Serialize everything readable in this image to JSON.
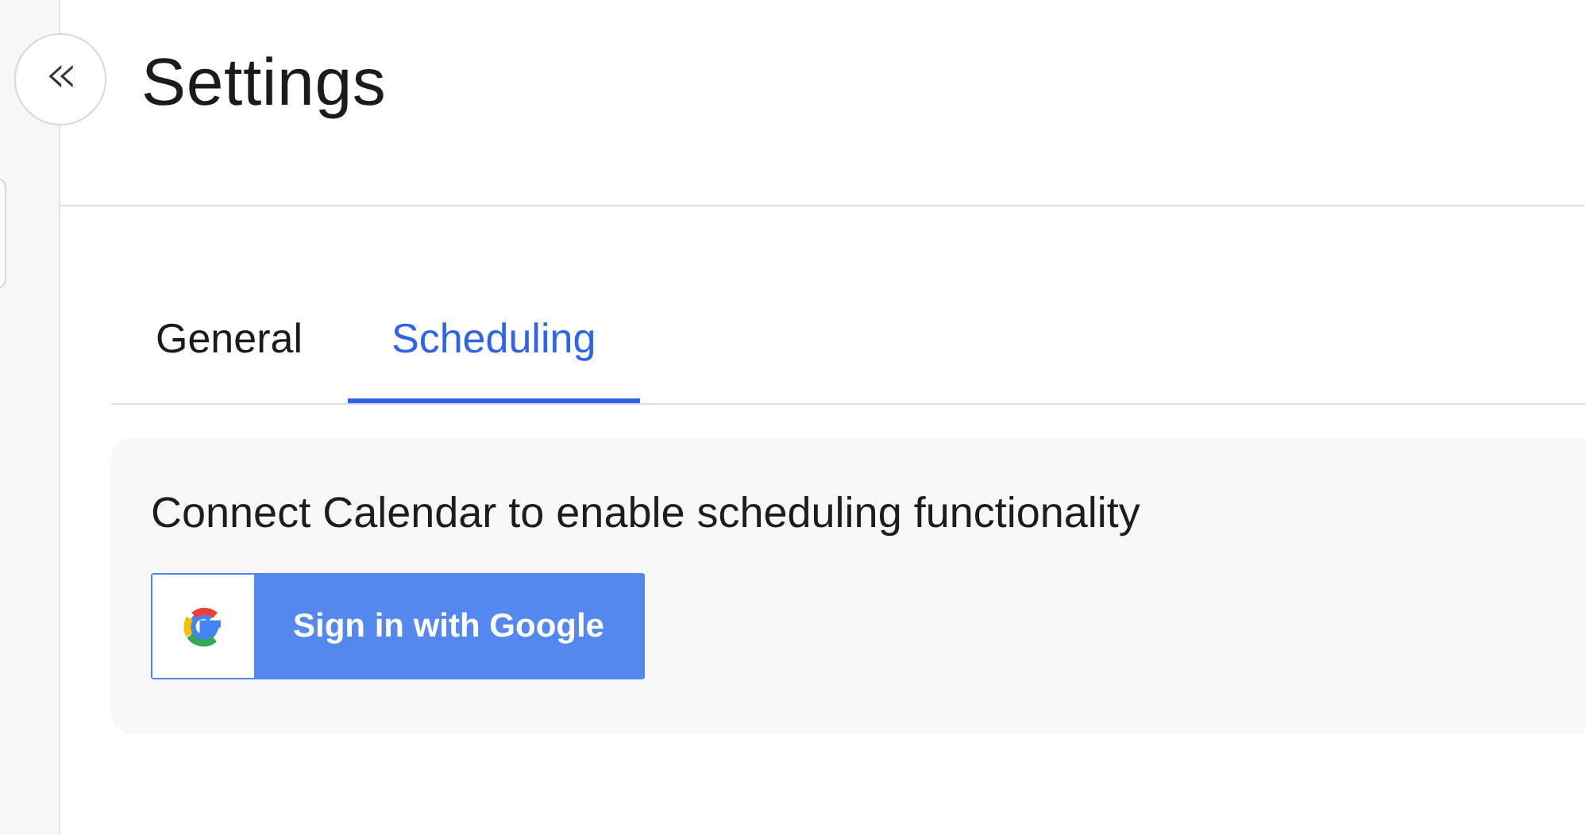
{
  "collapse_button": {
    "icon": "«"
  },
  "header": {
    "title": "Settings"
  },
  "tabs": [
    {
      "label": "General",
      "selected": false
    },
    {
      "label": "Scheduling",
      "selected": true
    }
  ],
  "calendar_card": {
    "message": "Connect Calendar to enable scheduling functionality",
    "button": "Sign in with Google"
  }
}
